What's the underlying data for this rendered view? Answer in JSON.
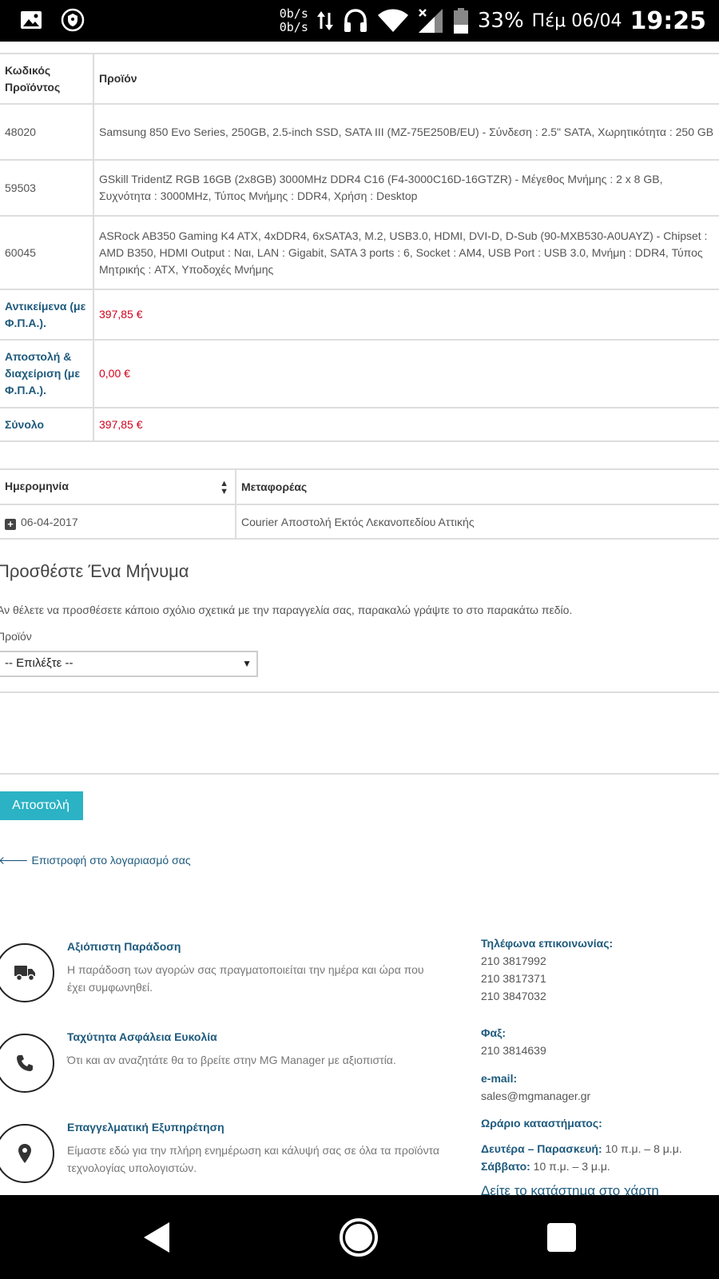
{
  "status_bar": {
    "net_up": "0b/s",
    "net_down": "0b/s",
    "battery": "33%",
    "date": "Πέμ 06/04",
    "time": "19:25",
    "icons": [
      "image-icon",
      "shield-icon",
      "data-arrows-icon",
      "headset-icon",
      "wifi-icon",
      "signal-icon",
      "battery-icon"
    ]
  },
  "orders_table": {
    "headers": {
      "code": "Κωδικός Προϊόντος",
      "product": "Προϊόν"
    },
    "rows": [
      {
        "code": "48020",
        "product": "Samsung 850 Evo Series, 250GB, 2.5-inch SSD, SATA III (MZ-75E250B/EU) - Σύνδεση : 2.5\" SATA, Χωρητικότητα : 250 GB"
      },
      {
        "code": "59503",
        "product": "GSkill TridentZ RGB 16GB (2x8GB) 3000MHz DDR4 C16 (F4-3000C16D-16GTZR) - Μέγεθος Μνήμης : 2 x 8 GB, Συχνότητα : 3000MHz, Τύπος Μνήμης : DDR4, Χρήση : Desktop"
      },
      {
        "code": "60045",
        "product_line1": "ASRock AB350 Gaming K4 ATX, 4xDDR4, 6xSATA3, M.2, USB3.0, HDMI, DVI-D, D-Sub (90-MXB530-A0UAYZ) - Chipset :",
        "product_rest": "AMD B350, HDMI Output : Ναι, LAN : Gigabit, SATA 3 ports : 6, Socket : AM4, USB Port : USB 3.0, Μνήμη : DDR4, Τύπος Μητρικής : ATX, Υποδοχές Μνήμης"
      }
    ],
    "totals": [
      {
        "label": "Αντικείμενα (με Φ.Π.Α.).",
        "value": "397,85 €"
      },
      {
        "label": "Αποστολή & διαχείριση (με Φ.Π.Α.).",
        "value": "0,00 €"
      },
      {
        "label": "Σύνολο",
        "value": "397,85 €"
      }
    ]
  },
  "shipping_table": {
    "headers": {
      "date": "Ημερομηνία",
      "carrier": "Μεταφορέας"
    },
    "row": {
      "date": "06-04-2017",
      "carrier": "Courier Αποστολή Εκτός Λεκανοπεδίου Αττικής"
    }
  },
  "message_form": {
    "title": "Προσθέστε Ένα Μήνυμα",
    "description": "Αν θέλετε να προσθέσετε κάποιο σχόλιο σχετικά με την παραγγελία σας, παρακαλώ γράψτε το στο παρακάτω πεδίο.",
    "product_label": "Προϊόν",
    "select_value": "-- Επιλέξτε --",
    "send_label": "Αποστολή",
    "back_label": "Επιστροφή στο λογαριασμό σας"
  },
  "features": [
    {
      "title": "Αξιόπιστη Παράδοση",
      "desc": "Η παράδοση των αγορών σας πραγματοποιείται την ημέρα και ώρα που έχει συμφωνηθεί.",
      "icon": "truck-icon"
    },
    {
      "title": "Ταχύτητα Ασφάλεια Ευκολία",
      "desc": "Ότι και αν αναζητάτε θα το βρείτε στην MG Manager με αξιοπιστία.",
      "icon": "phone-icon"
    },
    {
      "title": "Επαγγελματική Εξυπηρέτηση",
      "desc": "Είμαστε εδώ για την πλήρη ενημέρωση και κάλυψή σας σε όλα τα προϊόντα τεχνολογίας υπολογιστών.",
      "icon": "map-pin-icon"
    }
  ],
  "contact": {
    "phones_label": "Τηλέφωνα επικοινωνίας:",
    "phones": [
      "210 3817992",
      "210 3817371",
      "210 3847032"
    ],
    "fax_label": "Φαξ:",
    "fax": "210 3814639",
    "email_label": "e-mail:",
    "email": "sales@mgmanager.gr",
    "hours_label": "Ωράριο καταστήματος:",
    "weekdays_label": "Δευτέρα – Παρασκευή:",
    "weekdays_hours": "10 π.μ. – 8 μ.μ.",
    "saturday_label": "Σάββατο:",
    "saturday_hours": "10 π.μ. – 3 μ.μ.",
    "map_link": "Δείτε το κατάστημα στο χάρτη"
  },
  "nav_bar": {
    "icons": [
      "back-icon",
      "home-icon",
      "recents-icon"
    ]
  }
}
